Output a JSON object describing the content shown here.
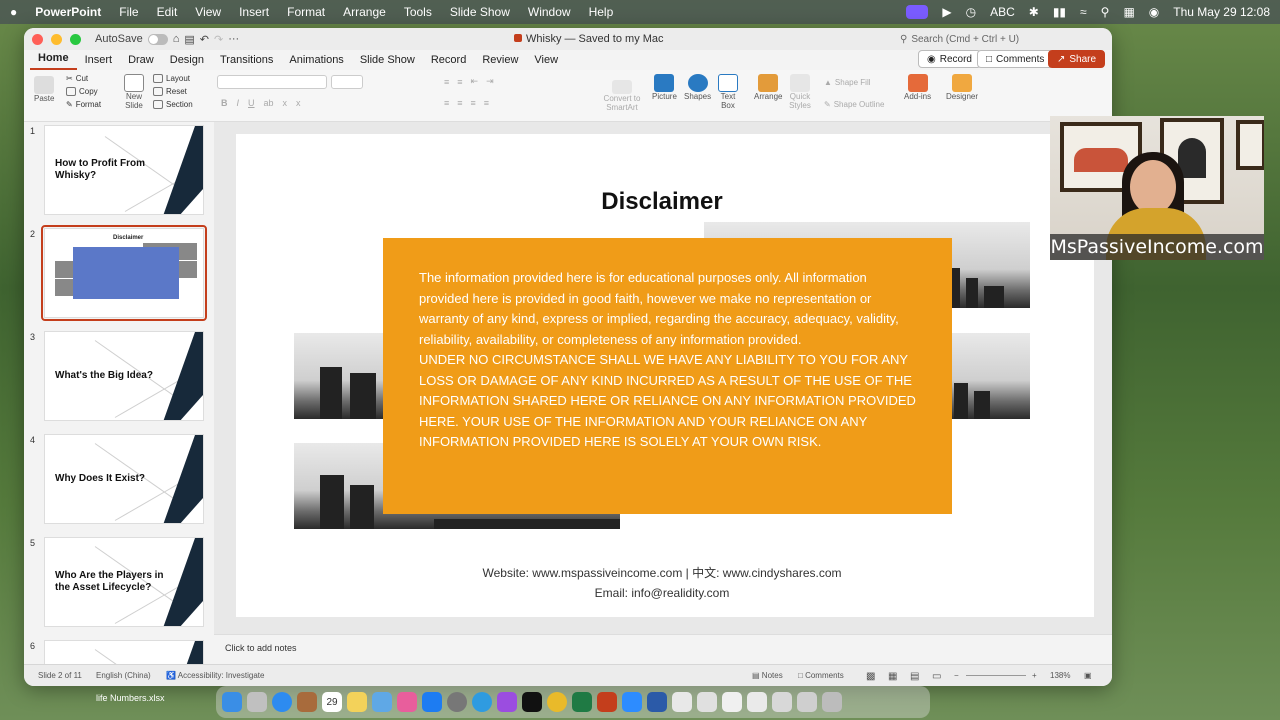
{
  "menubar": {
    "apple": "",
    "app_name": "PowerPoint",
    "items": [
      "File",
      "Edit",
      "View",
      "Insert",
      "Format",
      "Arrange",
      "Tools",
      "Slide Show",
      "Window",
      "Help"
    ],
    "input_label": "ABC",
    "clock": "Thu May 29  12:08"
  },
  "window": {
    "autosave_label": "AutoSave",
    "doc_title": "Whisky — Saved to my Mac",
    "search_placeholder": "Search (Cmd + Ctrl + U)"
  },
  "tabs": [
    "Home",
    "Insert",
    "Draw",
    "Design",
    "Transitions",
    "Animations",
    "Slide Show",
    "Record",
    "Review",
    "View"
  ],
  "active_tab": "Home",
  "tab_buttons": {
    "record": "Record",
    "comments": "Comments",
    "share": "Share"
  },
  "ribbon": {
    "paste": "Paste",
    "cut": "Cut",
    "copy": "Copy",
    "format": "Format",
    "new_slide": "New Slide",
    "layout": "Layout",
    "reset": "Reset",
    "section": "Section",
    "convert": "Convert to SmartArt",
    "picture": "Picture",
    "shapes": "Shapes",
    "text_box": "Text Box",
    "arrange": "Arrange",
    "quick_styles": "Quick Styles",
    "shape_fill": "Shape Fill",
    "shape_outline": "Shape Outline",
    "add_ins": "Add-ins",
    "designer": "Designer"
  },
  "thumbnails": [
    {
      "num": "1",
      "title": "How to Profit From Whisky?"
    },
    {
      "num": "2",
      "title": "Disclaimer"
    },
    {
      "num": "3",
      "title": "What's the Big Idea?"
    },
    {
      "num": "4",
      "title": "Why Does It Exist?"
    },
    {
      "num": "5",
      "title": "Who Are the Players in the Asset Lifecycle?"
    },
    {
      "num": "6",
      "title": ""
    }
  ],
  "slide": {
    "title": "Disclaimer",
    "body": "The information provided here is for educational purposes only. All information provided here is provided in good faith, however we make no representation or warranty of any kind, express or implied, regarding the accuracy, adequacy, validity, reliability, availability, or completeness of any information provided.",
    "body_caps": "UNDER NO CIRCUMSTANCE SHALL WE HAVE ANY LIABILITY TO YOU FOR ANY LOSS OR DAMAGE OF ANY KIND INCURRED AS A RESULT OF THE USE OF THE INFORMATION SHARED HERE OR RELIANCE ON ANY INFORMATION PROVIDED HERE. YOUR USE OF THE INFORMATION AND YOUR RELIANCE ON ANY INFORMATION PROVIDED HERE IS SOLELY AT YOUR OWN RISK.",
    "footer_website": "Website: www.mspassiveincome.com | 中文: www.cindyshares.com",
    "footer_email": "Email: info@realidity.com"
  },
  "notes_placeholder": "Click to add notes",
  "statusbar": {
    "slide_pos": "Slide 2 of 11",
    "language": "English (China)",
    "accessibility": "Accessibility: Investigate",
    "notes": "Notes",
    "comments": "Comments",
    "zoom": "138%"
  },
  "webcam_caption": "MsPassiveIncome.com",
  "desktop_file": "life Numbers.xlsx",
  "calendar_day": "29",
  "colors": {
    "accent": "#c43e1c",
    "orange": "#f09c18",
    "navy": "#17293a"
  }
}
